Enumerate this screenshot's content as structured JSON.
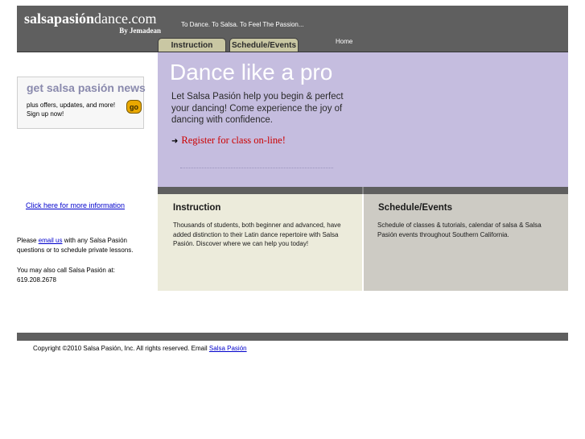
{
  "header": {
    "logo_bold": "salsapasión",
    "logo_rest": "dance.com",
    "logo_byline": "By Jemadean",
    "tagline": "To Dance.  To Salsa.  To Feel The Passion...",
    "tabs": [
      {
        "label": "Instruction"
      },
      {
        "label": "Schedule/Events"
      }
    ],
    "home_label": "Home"
  },
  "hero": {
    "title": "Dance like a pro",
    "text": "Let Salsa Pasión help you begin & perfect your dancing!  Come experience the joy of dancing with confidence.",
    "register_label": "Register for class on-line!"
  },
  "sidebar": {
    "news_title": "get salsa pasión news",
    "news_line1": "plus offers, updates, and more!",
    "news_line2": "Sign up now!",
    "go_label": "go",
    "more_info_link": "Click here for more information",
    "email_prefix": "Please ",
    "email_link": "email us",
    "email_suffix": " with any Salsa Pasión questions or to schedule private lessons.",
    "call_text": "You may also call Salsa Pasión at: 619.208.2678"
  },
  "panels": {
    "instruction": {
      "title": "Instruction",
      "text": "Thousands of students, both beginner and advanced, have added distinction to their Latin dance repertoire with Salsa Pasión. Discover where we can help you today!"
    },
    "schedule": {
      "title": "Schedule/Events",
      "text": "Schedule of classes & tutorials, calendar of salsa & Salsa Pasión events throughout Southern California."
    }
  },
  "footer": {
    "copyright": "Copyright ©2010 Salsa Pasión, Inc. All rights reserved. Email ",
    "email_link": "Salsa Pasión"
  }
}
